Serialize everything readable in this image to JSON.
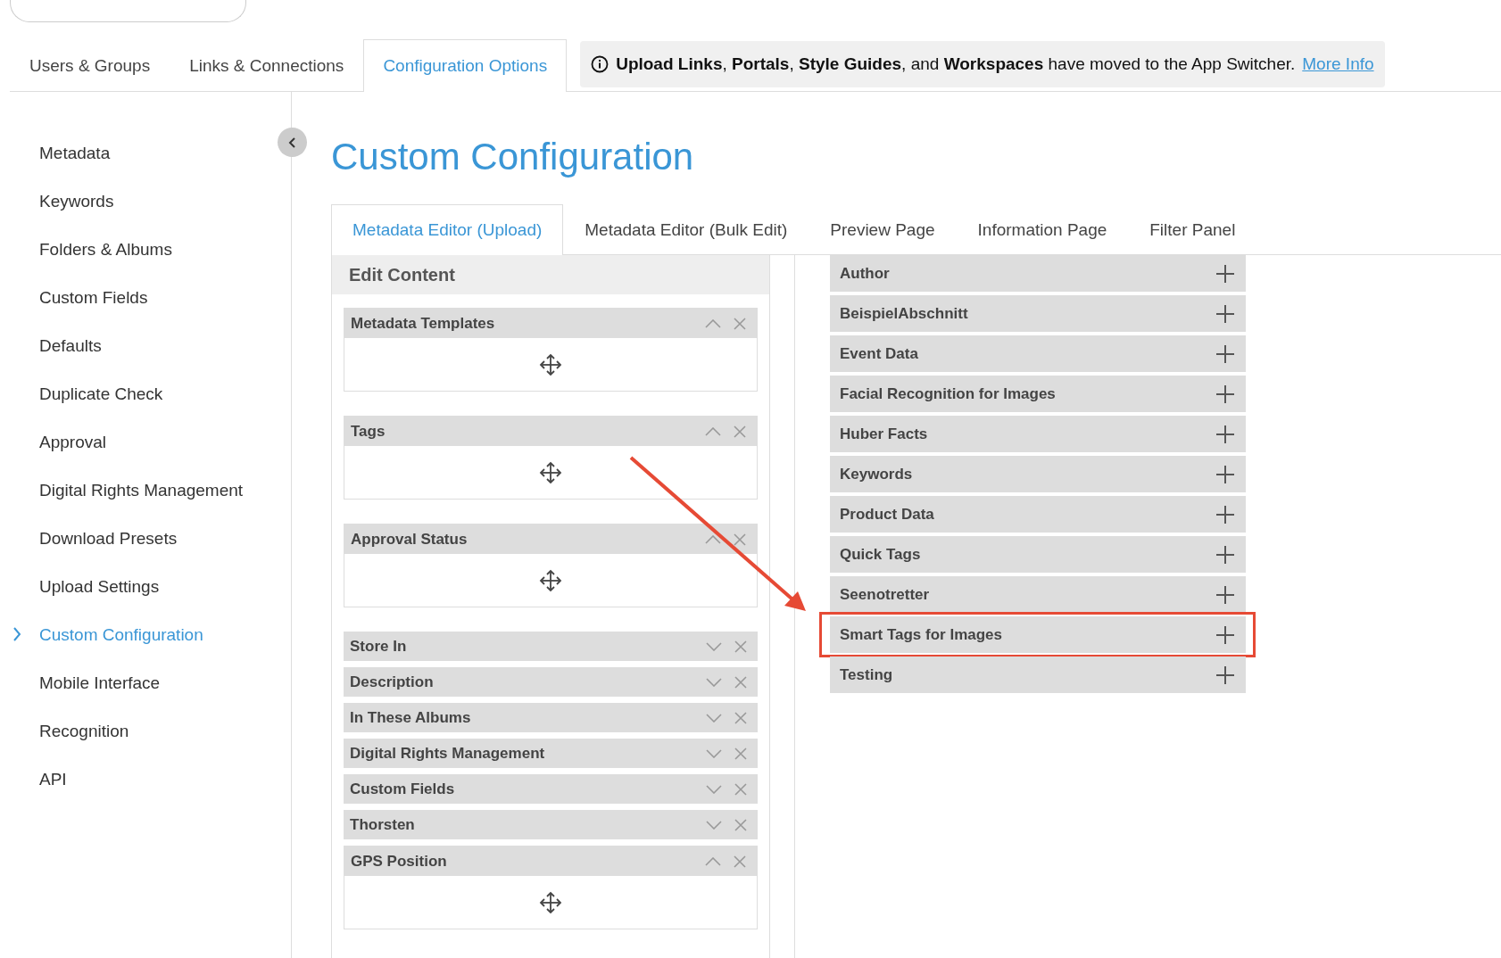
{
  "top_tabs": [
    {
      "label": "Users & Groups",
      "selected": false
    },
    {
      "label": "Links & Connections",
      "selected": false
    },
    {
      "label": "Configuration Options",
      "selected": true
    }
  ],
  "notice": {
    "text": "**Upload Links**, **Portals**, **Style Guides**, and **Workspaces** have moved to the App Switcher.",
    "link": "More Info"
  },
  "sidebar": {
    "items": [
      {
        "label": "Metadata",
        "selected": false
      },
      {
        "label": "Keywords",
        "selected": false
      },
      {
        "label": "Folders & Albums",
        "selected": false
      },
      {
        "label": "Custom Fields",
        "selected": false
      },
      {
        "label": "Defaults",
        "selected": false
      },
      {
        "label": "Duplicate Check",
        "selected": false
      },
      {
        "label": "Approval",
        "selected": false
      },
      {
        "label": "Digital Rights Management",
        "selected": false
      },
      {
        "label": "Download Presets",
        "selected": false
      },
      {
        "label": "Upload Settings",
        "selected": false
      },
      {
        "label": "Custom Configuration",
        "selected": true
      },
      {
        "label": "Mobile Interface",
        "selected": false
      },
      {
        "label": "Recognition",
        "selected": false
      },
      {
        "label": "API",
        "selected": false
      }
    ]
  },
  "page_title": "Custom Configuration",
  "tabs": [
    {
      "label": "Metadata Editor (Upload)",
      "selected": true
    },
    {
      "label": "Metadata Editor (Bulk Edit)",
      "selected": false
    },
    {
      "label": "Preview Page",
      "selected": false
    },
    {
      "label": "Information Page",
      "selected": false
    },
    {
      "label": "Filter Panel",
      "selected": false
    }
  ],
  "edit_panel": {
    "title": "Edit Content",
    "widgets": [
      {
        "title": "Metadata Templates",
        "expanded": true
      },
      {
        "title": "Tags",
        "expanded": true
      },
      {
        "title": "Approval Status",
        "expanded": true
      },
      {
        "title": "Store In",
        "expanded": false
      },
      {
        "title": "Description",
        "expanded": false
      },
      {
        "title": "In These Albums",
        "expanded": false
      },
      {
        "title": "Digital Rights Management",
        "expanded": false
      },
      {
        "title": "Custom Fields",
        "expanded": false
      },
      {
        "title": "Thorsten",
        "expanded": false
      },
      {
        "title": "GPS Position",
        "expanded": true
      }
    ]
  },
  "available_sections": [
    {
      "title": "Author",
      "highlighted": false
    },
    {
      "title": "BeispielAbschnitt",
      "highlighted": false
    },
    {
      "title": "Event Data",
      "highlighted": false
    },
    {
      "title": "Facial Recognition for Images",
      "highlighted": false
    },
    {
      "title": "Huber Facts",
      "highlighted": false
    },
    {
      "title": "Keywords",
      "highlighted": false
    },
    {
      "title": "Product Data",
      "highlighted": false
    },
    {
      "title": "Quick Tags",
      "highlighted": false
    },
    {
      "title": "Seenotretter",
      "highlighted": false
    },
    {
      "title": "Smart Tags for Images",
      "highlighted": true
    },
    {
      "title": "Testing",
      "highlighted": false
    }
  ]
}
